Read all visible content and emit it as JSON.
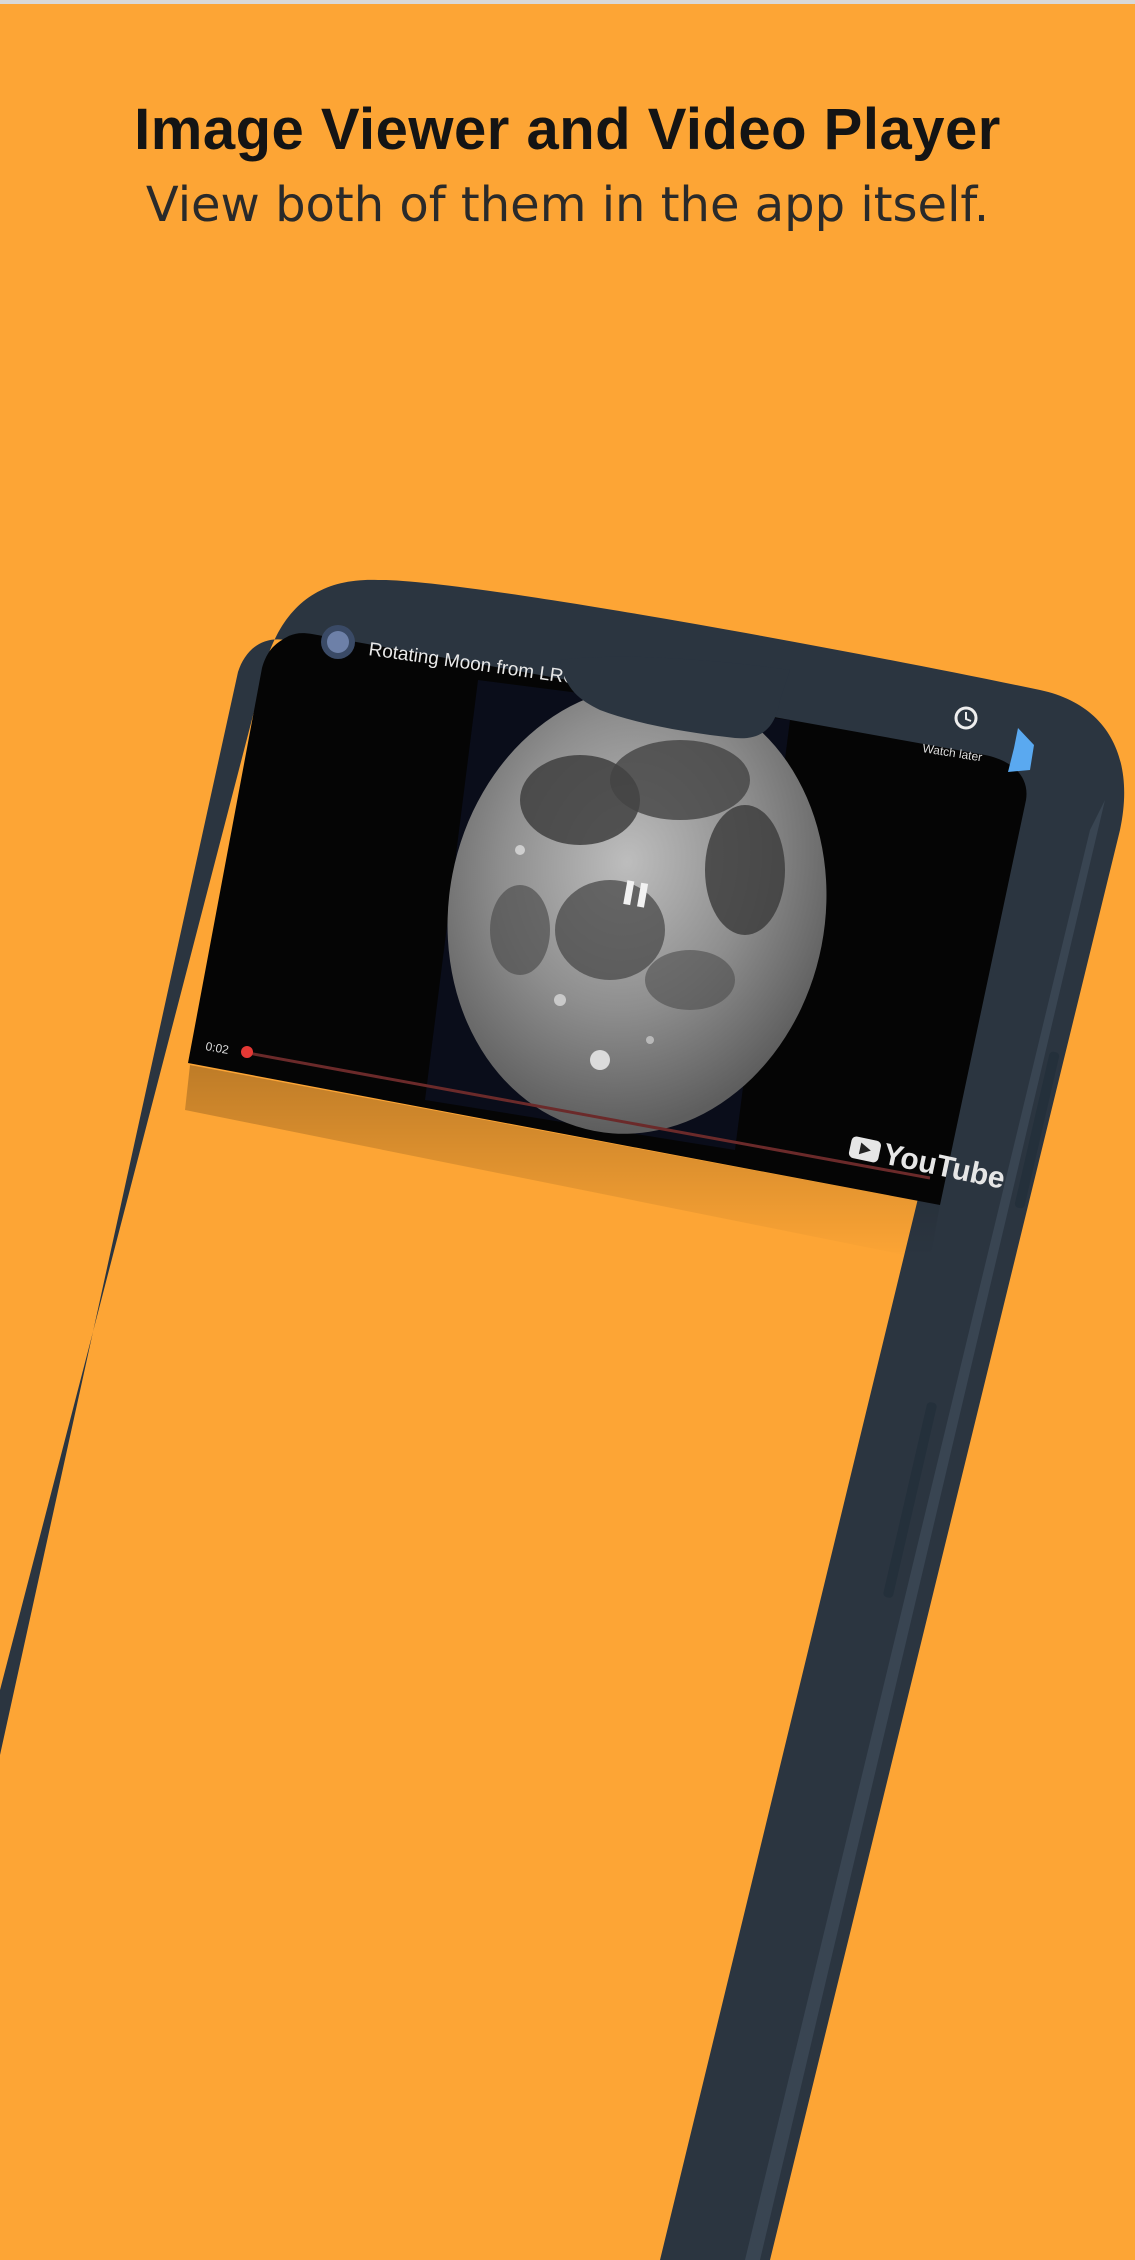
{
  "page": {
    "title": "Image Viewer and Video Player",
    "subtitle": "View both of them in the app itself.",
    "background_color": "#FDA535"
  },
  "phone": {
    "frame_color": "#2B3540",
    "video_player": {
      "video_title": "Rotating Moon from LRO",
      "time_elapsed": "0:02",
      "top_right_label": "Watch later",
      "brand": "YouTube",
      "state": "paused",
      "icons": [
        "channel-avatar-icon",
        "clock-icon",
        "share-icon",
        "pause-icon",
        "youtube-logo-icon"
      ],
      "accent_color": "#e53935"
    }
  }
}
